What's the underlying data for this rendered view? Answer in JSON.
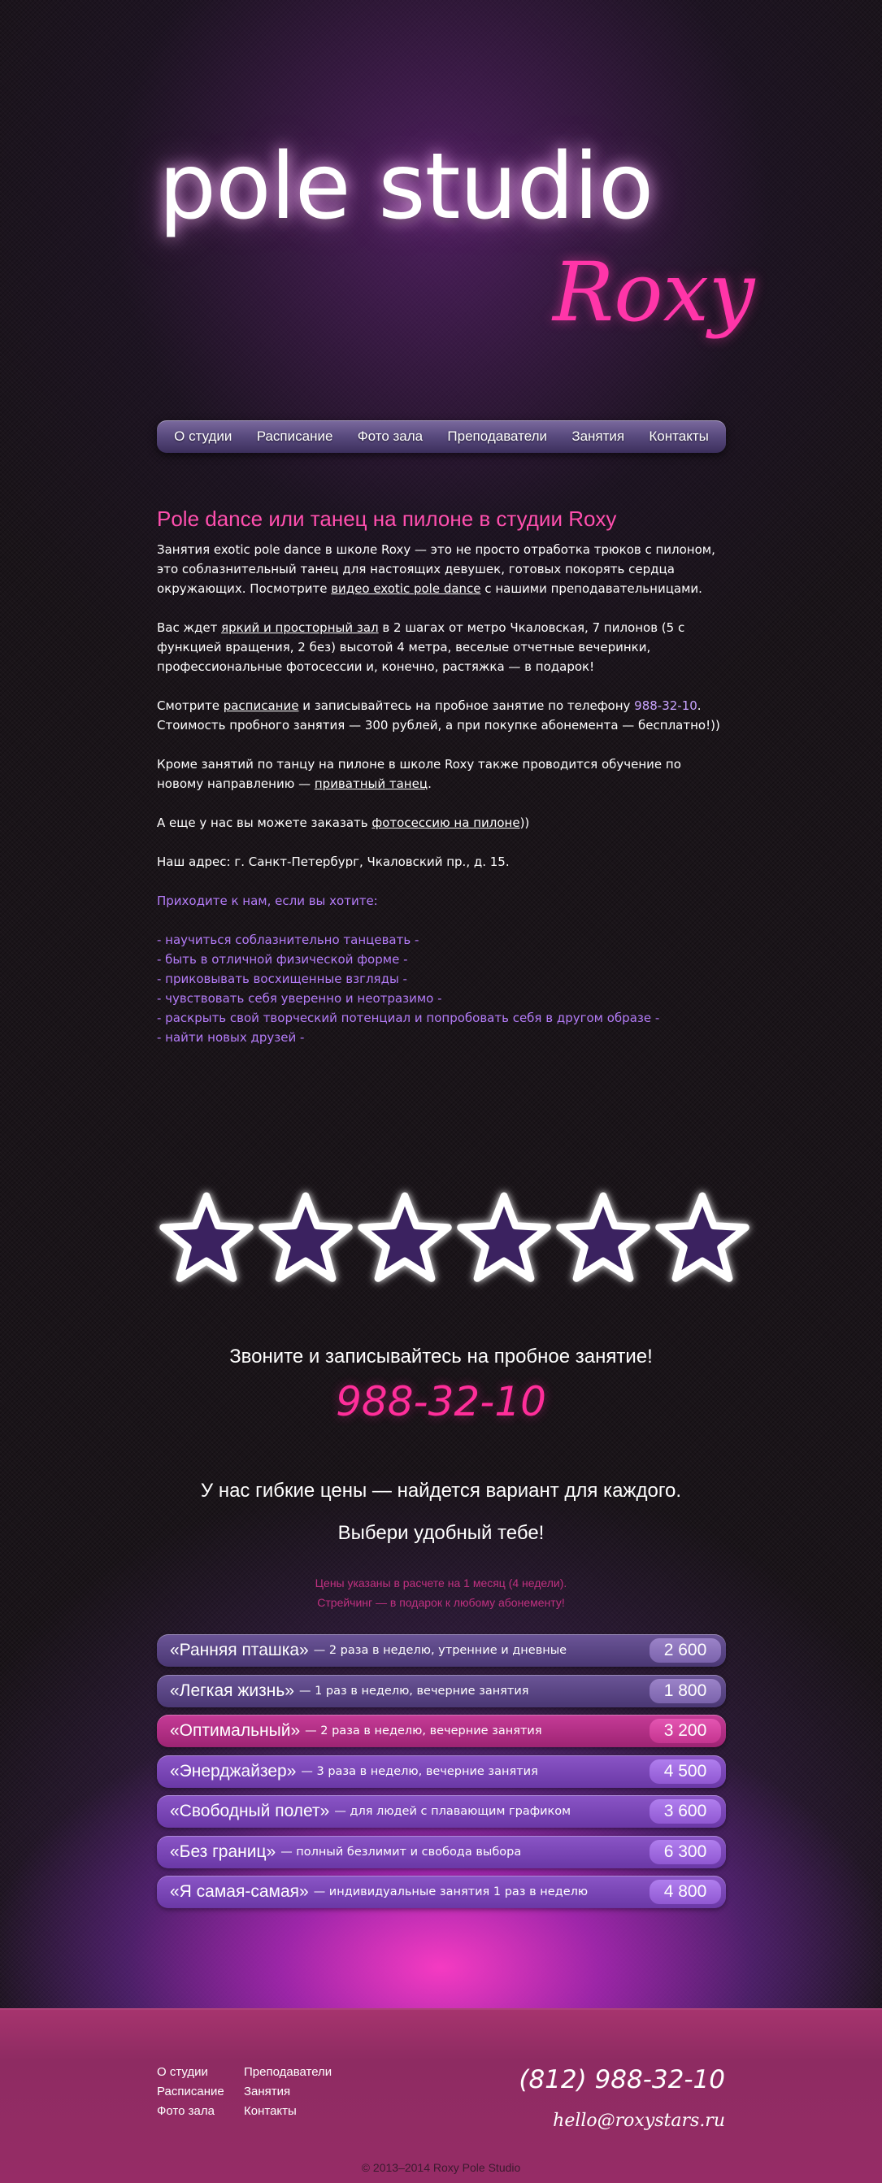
{
  "header": {
    "title": "pole studio",
    "subtitle": "Roxy"
  },
  "nav": {
    "items": [
      {
        "label": "О студии"
      },
      {
        "label": "Расписание"
      },
      {
        "label": "Фото зала"
      },
      {
        "label": "Преподаватели"
      },
      {
        "label": "Занятия"
      },
      {
        "label": "Контакты"
      }
    ]
  },
  "content": {
    "heading": "Pole dance или танец на пилоне в студии Roxy",
    "p1_text1": "Занятия exotic pole dance в школе Roxy — это не просто отработка трюков с пилоном, это соблазнительный танец для настоящих девушек, готовых покорять сердца окружающих. Посмотрите ",
    "p1_link": "видео exotic pole dance",
    "p1_text2": " с нашими преподавательницами.",
    "p2_text1": "Вас ждет ",
    "p2_link": "яркий и просторный зал",
    "p2_text2": " в 2 шагах от метро Чкаловская, 7 пилонов (5 с функцией вращения, 2 без) высотой 4 метра, веселые отчетные вечеринки, профессиональные фотосессии и, конечно, растяжка — в подарок!",
    "p3_text1": "Смотрите ",
    "p3_link": "расписание",
    "p3_text2": " и записывайтесь на пробное занятие по телефону ",
    "p3_phone": "988-32-10",
    "p3_text3": ". Стоимость пробного занятия — 300 рублей, а при покупке абонемента — бесплатно!))",
    "p4_text1": "Кроме занятий по танцу на пилоне в школе Roxy также проводится обучение по новому направлению — ",
    "p4_link": "приватный танец",
    "p4_text2": ".",
    "p5_text1": "А еще у нас вы можете заказать ",
    "p5_link": "фотосессию на пилоне",
    "p5_text2": "))",
    "address": "Наш адрес: г. Санкт-Петербург, Чкаловский пр., д. 15.",
    "invite": "Приходите к нам, если вы хотите:",
    "wishes": [
      "- научиться соблазнительно танцевать -",
      "- быть в отличной физической форме -",
      "- приковывать восхищенные взгляды -",
      "- чувствовать себя уверенно и неотразимо -",
      "- раскрыть свой творческий потенциал и попробовать себя в другом образе -",
      "- найти новых друзей -"
    ]
  },
  "stars": {
    "count": 6,
    "icon": "star-icon",
    "fill_color": "#3b2360",
    "stroke_color": "#ffffff"
  },
  "call": {
    "title": "Звоните и записывайтесь на пробное занятие!",
    "phone": "988-32-10"
  },
  "prices": {
    "title1": "У нас гибкие цены — найдется вариант для каждого.",
    "title2": "Выбери удобный тебе!",
    "note1": "Цены указаны в расчете на 1 месяц (4 недели).",
    "note2": "Стрейчинг — в подарок к любому абонементу!",
    "items": [
      {
        "name": "«Ранняя пташка»",
        "desc": "— 2 раза в неделю, утренние и дневные",
        "price": "2 600"
      },
      {
        "name": "«Легкая жизнь»",
        "desc": "— 1 раз в неделю, вечерние занятия",
        "price": "1 800"
      },
      {
        "name": "«Оптимальный»",
        "desc": "— 2 раза в неделю, вечерние занятия",
        "price": "3 200"
      },
      {
        "name": "«Энерджайзер»",
        "desc": "— 3 раза в неделю, вечерние занятия",
        "price": "4 500"
      },
      {
        "name": "«Свободный полет»",
        "desc": "— для людей с плавающим графиком",
        "price": "3 600"
      },
      {
        "name": "«Без границ»",
        "desc": "— полный безлимит и свобода выбора",
        "price": "6 300"
      },
      {
        "name": "«Я самая-самая»",
        "desc": "— индивидуальные занятия 1 раз в неделю",
        "price": "4 800"
      }
    ]
  },
  "footer": {
    "menu": [
      {
        "label": "О студии"
      },
      {
        "label": "Преподаватели"
      },
      {
        "label": "Расписание"
      },
      {
        "label": "Занятия"
      },
      {
        "label": "Фото зала"
      },
      {
        "label": "Контакты"
      }
    ],
    "phone": "(812) 988-32-10",
    "email": "hello@roxystars.ru",
    "copyright": "© 2013–2014 Roxy Pole Studio"
  },
  "colors": {
    "accent_pink": "#ff35a8",
    "accent_purple": "#b47cf8",
    "footer_bg": "#962c66"
  }
}
